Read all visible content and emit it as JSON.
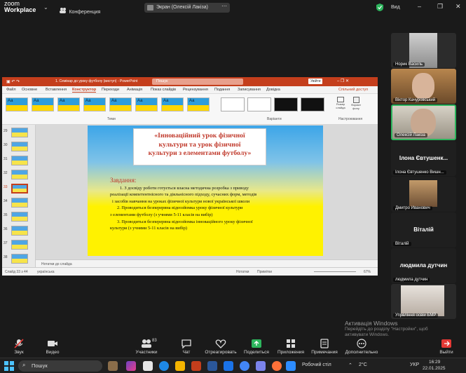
{
  "zoom": {
    "logo_top": "zoom",
    "logo_bottom": "Workplace",
    "meeting_label": "Конференция",
    "share_label": "Экран (Олексій Лакіза)",
    "view_label": "Вид"
  },
  "ppt": {
    "title": "1. Семінар до уроку футболу (виступ) - PowerPoint",
    "search": "Пошук",
    "signin": "Увійти",
    "menu": [
      "Файл",
      "Основне",
      "Вставлення",
      "Конструктор",
      "Переходи",
      "Анімація",
      "Показ слайдів",
      "Рецензування",
      "Подання",
      "Записування",
      "Довідка"
    ],
    "share": "Спільний доступ",
    "theme_label": "Аа",
    "group_themes": "Теми",
    "group_variants": "Варіанти",
    "group_settings": "Настроювання",
    "btn_size": "Розмір слайда",
    "btn_format": "Формат фону",
    "thumb_numbers": [
      "29",
      "30",
      "31",
      "32",
      "33",
      "34",
      "35",
      "36",
      "37",
      "38"
    ],
    "notes_placeholder": "Нотатки до слайда",
    "status_slide": "Слайд 33 з 44",
    "status_lang": "українська",
    "status_notes": "Нотатки",
    "status_comments": "Примітки",
    "zoom_pct": "67%"
  },
  "slide": {
    "title_lines": [
      "«Інноваційний урок фізичної",
      "культури та урок фізичної",
      "культури з елементами футболу»"
    ],
    "heading": "Завдання:",
    "body_lines": [
      "1. З досвіду роботи готується власна методична розробка з приводу",
      "реалізації компетентнісного та діяльнісного підходу, сучасних форм, методів",
      "і засобів навчання на уроках фізичної культури  нової української школи",
      "2. Проводиться безперервна відеозйомка уроку фізичної культури",
      "з елементами футболу (з учнями 5-11 класів на вибір)",
      "3. Проводиться безперервна відеозйомка інноваційного уроку фізичної",
      "культури (з учнями 5-11 класів на вибір)"
    ]
  },
  "participants": [
    {
      "name": "Норик Василь"
    },
    {
      "name": "Віктор Качуровський"
    },
    {
      "name": "Олексій Лакіза"
    },
    {
      "big": "Ілона Євтушенк...",
      "name": "Ілона Євтушенко Вишн..."
    },
    {
      "name": "Дмитро Иванович"
    },
    {
      "big": "Віталій",
      "name": "Віталій"
    },
    {
      "big": "людмила дутчин",
      "name": "людмила дутчин"
    },
    {
      "name": "Упрвління освіи БМР"
    }
  ],
  "toolbar": {
    "items": [
      "Звук",
      "Видео",
      "Участники",
      "Чат",
      "Отреагировать",
      "Поделиться",
      "Приложения",
      "Примечания",
      "Дополнительно",
      "Выйти"
    ],
    "participants_count": "83"
  },
  "activation": {
    "title": "Активація Windows",
    "line1": "Перейдіть до розділу \"Настройки\", щоб",
    "line2": "активувати Windows."
  },
  "taskbar": {
    "search": "Пошук",
    "desk": "Робочий стіл",
    "weather": "2°C",
    "lang": "УКР",
    "time": "16:29",
    "date": "22.01.2025"
  },
  "colors": {
    "ppt_accent": "#c43e1c",
    "zoom_green": "#2db55d",
    "slide_title": "#c0392b"
  }
}
